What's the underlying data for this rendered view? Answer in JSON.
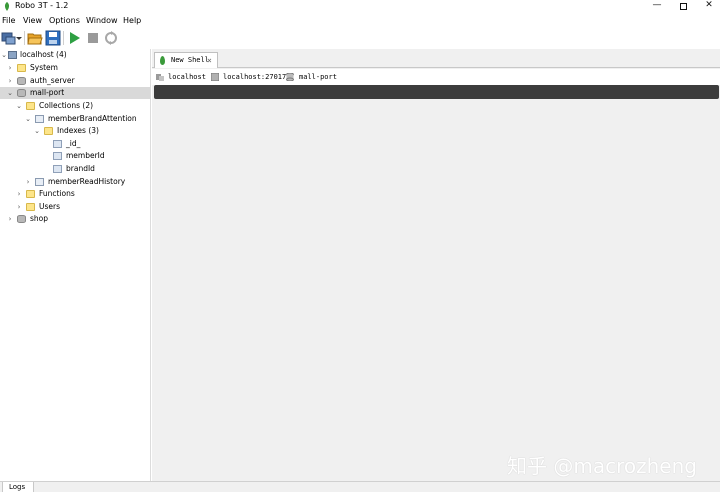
{
  "window": {
    "title": "Robo 3T - 1.2",
    "controls": {
      "minimize": "—",
      "close": "✕"
    }
  },
  "menu": [
    "File",
    "View",
    "Options",
    "Window",
    "Help"
  ],
  "toolbar": {
    "buttons": [
      "connect-icon",
      "dropdown-icon",
      "open-icon",
      "save-icon",
      "run-icon",
      "stop-icon",
      "rotate-icon"
    ]
  },
  "tree": {
    "server": "localhost (4)",
    "system": "System",
    "auth_server": "auth_server",
    "mall_port": "mall-port",
    "collections": "Collections (2)",
    "collection_1": "memberBrandAttention",
    "indexes": "Indexes (3)",
    "index_1": "_id_",
    "index_2": "memberId",
    "index_3": "brandId",
    "collection_2": "memberReadHistory",
    "functions": "Functions",
    "users": "Users",
    "shop": "shop"
  },
  "shell": {
    "tab_label": "New Shell",
    "tab_close": "×",
    "server": "localhost",
    "address": "localhost:27017",
    "database": "mall-port"
  },
  "watermark": "知乎 @macrozheng",
  "logs_tab": "Logs",
  "colors": {
    "selection": "#d9d9d9",
    "command_bar": "#3c3c3c",
    "run_green": "#2ea043",
    "folder": "#fde58a"
  }
}
